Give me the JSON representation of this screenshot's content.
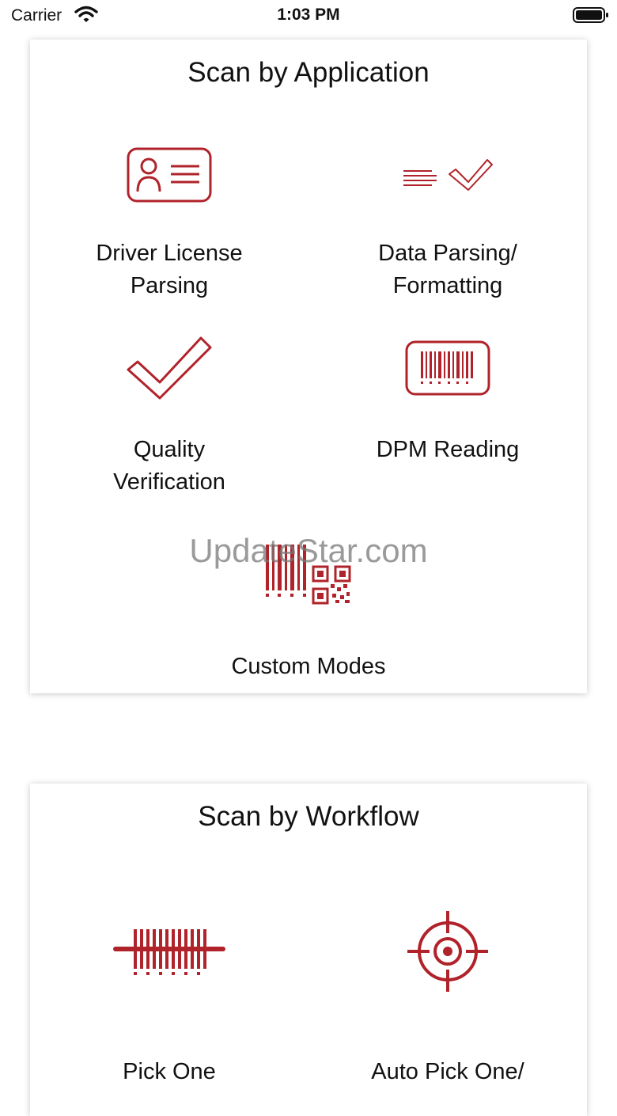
{
  "status_bar": {
    "carrier": "Carrier",
    "time": "1:03 PM"
  },
  "colors": {
    "accent": "#b0232a",
    "text": "#111111",
    "card_bg": "#ffffff"
  },
  "scan_by_application": {
    "title": "Scan by Application",
    "items": [
      {
        "label": "Driver License\nParsing",
        "icon": "id-card-icon"
      },
      {
        "label": "Data Parsing/\nFormatting",
        "icon": "lines-check-icon"
      },
      {
        "label": "Quality\nVerification",
        "icon": "checkmark-icon"
      },
      {
        "label": "DPM Reading",
        "icon": "barcode-frame-icon"
      },
      {
        "label": "Custom Modes",
        "icon": "barcode-qr-icon"
      }
    ]
  },
  "scan_by_workflow": {
    "title": "Scan by Workflow",
    "items": [
      {
        "label": "Pick One",
        "icon": "barcode-laser-icon"
      },
      {
        "label": "Auto Pick One/",
        "icon": "crosshair-target-icon"
      }
    ]
  },
  "watermark": "UpdateStar.com"
}
